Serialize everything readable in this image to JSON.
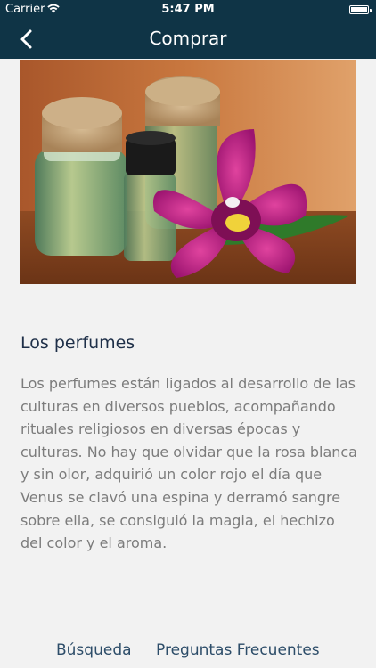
{
  "status_bar": {
    "carrier": "Carrier",
    "time": "5:47 PM",
    "icons": [
      "wifi-icon",
      "battery-icon"
    ]
  },
  "nav": {
    "title": "Comprar",
    "back_icon": "chevron-left-icon"
  },
  "colors": {
    "header_bg": "#0f3446",
    "page_bg": "#f2f2f2",
    "heading": "#1e2f48",
    "body_text": "#7c7c7c",
    "link": "#2d4d69"
  },
  "hero_image": {
    "subject": "perfume-bottles-with-orchid"
  },
  "article": {
    "heading": "Los perfumes",
    "body": "Los perfumes están ligados al desarrollo de las culturas en diversos pueblos, acompañando rituales religiosos en diversas épocas y culturas. No hay que olvidar que la rosa blanca y sin olor, adquirió un color rojo el día que Venus se clavó una espina y derramó sangre sobre ella, se consiguió la magia, el hechizo del color y el aroma."
  },
  "footer": {
    "search_label": "Búsqueda",
    "faq_label": "Preguntas Frecuentes"
  }
}
